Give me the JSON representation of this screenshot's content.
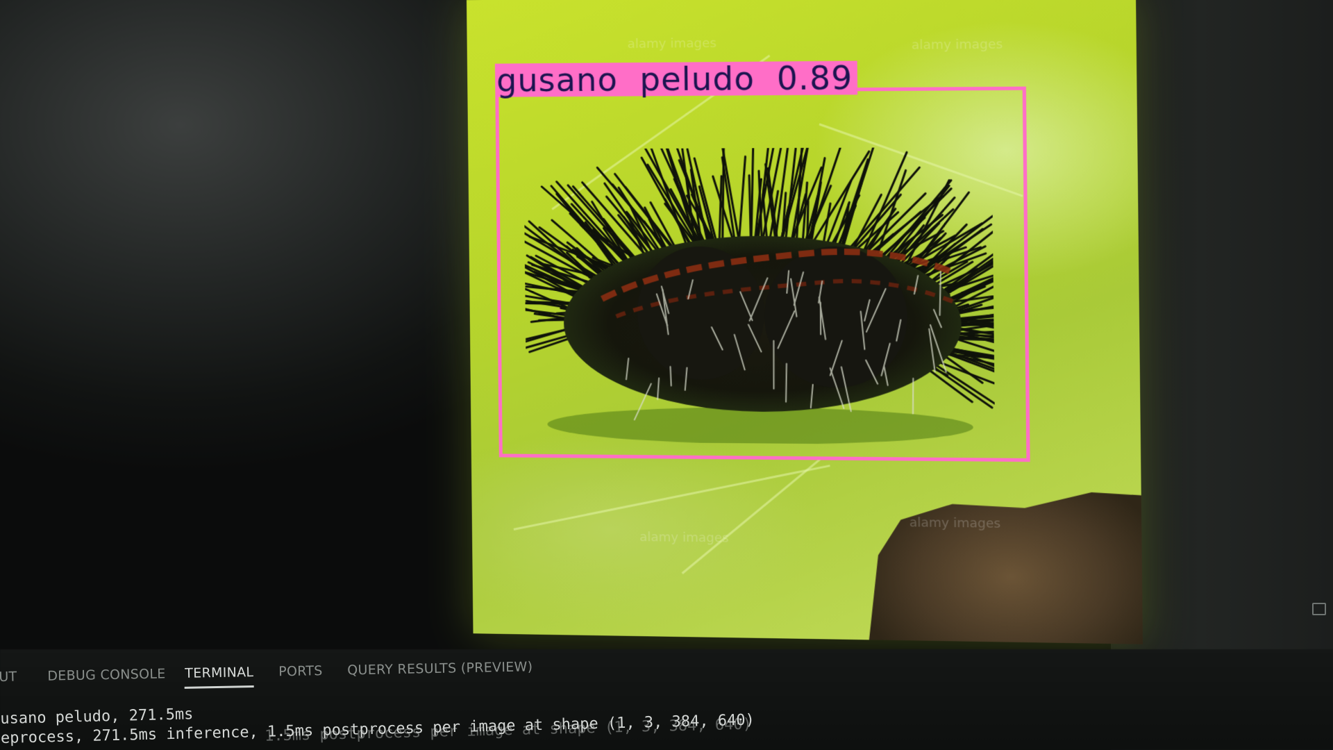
{
  "detection": {
    "label": "gusano  peludo  0.89",
    "box_color": "#ff6ec7",
    "label_text_color": "#1c1450"
  },
  "panel": {
    "tabs": [
      {
        "label": "UT",
        "active": false
      },
      {
        "label": "DEBUG CONSOLE",
        "active": false
      },
      {
        "label": "TERMINAL",
        "active": true
      },
      {
        "label": "PORTS",
        "active": false
      },
      {
        "label": "QUERY RESULTS (PREVIEW)",
        "active": false
      }
    ],
    "terminal_lines": [
      "usano peludo, 271.5ms",
      "eprocess, 271.5ms inference, 1.5ms postprocess per image at shape (1, 3, 384, 640)"
    ],
    "terminal_ghost_line": "1.5ms postprocess per image at shape (1, 3, 384, 640)"
  },
  "icons": {
    "corner": "panel-toggle-icon"
  }
}
